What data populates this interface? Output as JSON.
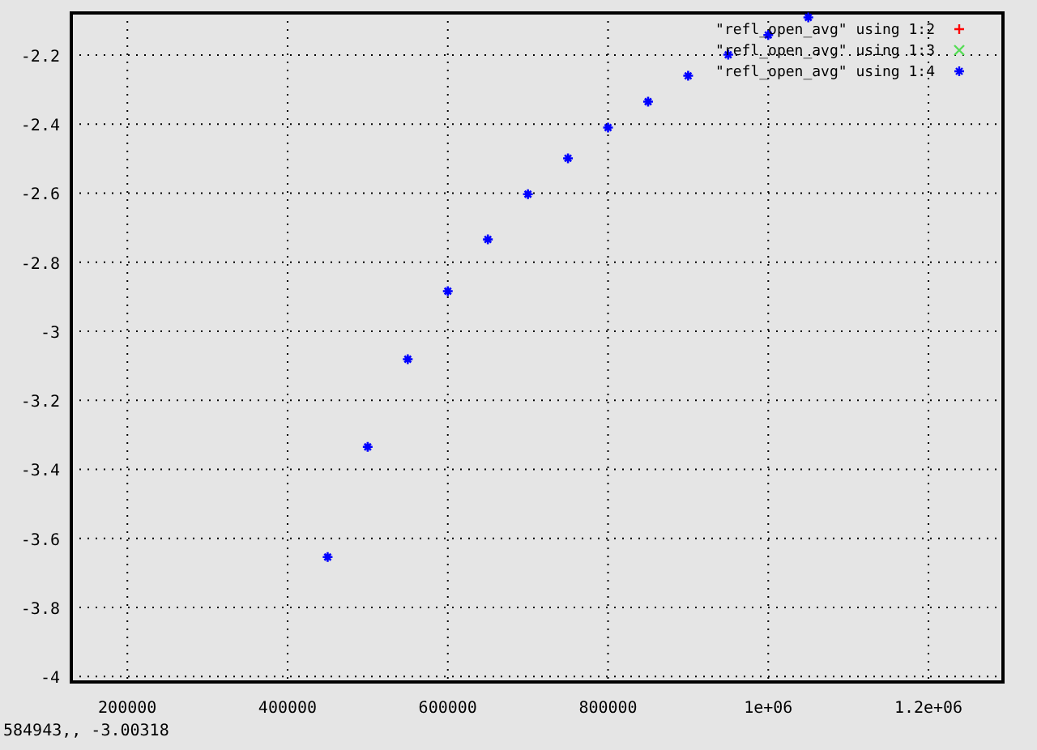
{
  "chart_data": {
    "type": "scatter",
    "grid": true,
    "x": [
      450000,
      500000,
      550000,
      600000,
      650000,
      700000,
      750000,
      800000,
      850000,
      900000,
      950000,
      1000000,
      1050000
    ],
    "series": [
      {
        "name": "\"refl_open_avg\" using 1:2",
        "color": "#ff0000",
        "values": [
          null,
          null,
          null,
          null,
          null,
          null,
          null,
          null,
          null,
          null,
          null,
          null,
          null
        ]
      },
      {
        "name": "\"refl_open_avg\" using 1:3",
        "color": "#55dd55",
        "values": [
          null,
          null,
          null,
          null,
          null,
          null,
          null,
          null,
          null,
          null,
          null,
          null,
          null
        ]
      },
      {
        "name": "\"refl_open_avg\" using 1:4",
        "color": "#0000ff",
        "values": [
          -3.654,
          -3.335,
          -3.081,
          -2.884,
          -2.734,
          -2.603,
          -2.499,
          -2.41,
          -2.335,
          -2.26,
          -2.199,
          -2.142,
          -2.091
        ]
      }
    ],
    "xlim": [
      130000,
      1293000
    ],
    "ylim": [
      -4.016,
      -2.078
    ],
    "xticks": [
      200000,
      400000,
      600000,
      800000,
      {
        "value": 1000000,
        "label": "1e+06"
      },
      {
        "value": 1200000,
        "label": "1.2e+06"
      }
    ],
    "yticks": [
      {
        "value": -2.2,
        "label": "-2.2"
      },
      {
        "value": -2.4,
        "label": "-2.4"
      },
      {
        "value": -2.6,
        "label": "-2.6"
      },
      {
        "value": -2.8,
        "label": "-2.8"
      },
      {
        "value": -3,
        "label": "-3"
      },
      {
        "value": -3.2,
        "label": "-3.2"
      },
      {
        "value": -3.4,
        "label": "-3.4"
      },
      {
        "value": -3.6,
        "label": "-3.6"
      },
      {
        "value": -3.8,
        "label": "-3.8"
      },
      {
        "value": -4,
        "label": "-4"
      }
    ]
  },
  "status_bar": "584943,, -3.00318"
}
